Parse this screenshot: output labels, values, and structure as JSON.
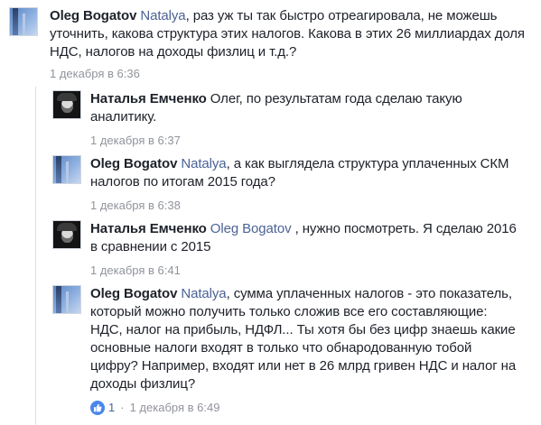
{
  "comments": [
    {
      "author": "Oleg Bogatov",
      "mention": "Natalya",
      "text_before": ", раз уж ты так быстро отреагировала, не можешь",
      "lines": [
        "уточнить, какова структура этих налогов. Какова в этих 26 миллиардах доля",
        "НДС, налогов на доходы физлиц и т.д.?"
      ],
      "timestamp": "1 декабря в 6:36",
      "avatar": "sky-building-photo"
    },
    {
      "author": "Наталья Емченко",
      "text_before": " Олег, по результатам года сделаю такую",
      "lines": [
        "аналитику."
      ],
      "timestamp": "1 декабря в 6:37",
      "avatar": "portrait-photo"
    },
    {
      "author": "Oleg Bogatov",
      "mention": "Natalya",
      "text_before": ", а как выглядела структура уплаченных СКМ",
      "lines": [
        "налогов по итогам 2015 года?"
      ],
      "timestamp": "1 декабря в 6:38",
      "avatar": "sky-building-photo"
    },
    {
      "author": "Наталья Емченко",
      "mention": "Oleg Bogatov",
      "text_before": " , нужно посмотреть. Я сделаю 2016",
      "lines": [
        "в сравнении с 2015"
      ],
      "timestamp": "1 декабря в 6:41",
      "avatar": "portrait-photo"
    },
    {
      "author": "Oleg Bogatov",
      "mention": "Natalya",
      "text_before": ", сумма уплаченных налогов - это показатель,",
      "lines": [
        "который можно получить только сложив все его составляющие:",
        "НДС, налог на прибыль, НДФЛ... Ты хотя бы без цифр знаешь какие",
        "основные налоги входят в только что обнародованную тобой",
        "цифру? Например, входят или нет в 26 млрд гривен НДС и налог на",
        "доходы физлиц?"
      ],
      "like_count": "1",
      "separator": "·",
      "timestamp": "1 декабря в 6:49",
      "avatar": "sky-building-photo"
    }
  ],
  "colors": {
    "text": "#1d2129",
    "mention": "#4b6295",
    "meta": "#90949c",
    "like": "#4a87ec"
  }
}
